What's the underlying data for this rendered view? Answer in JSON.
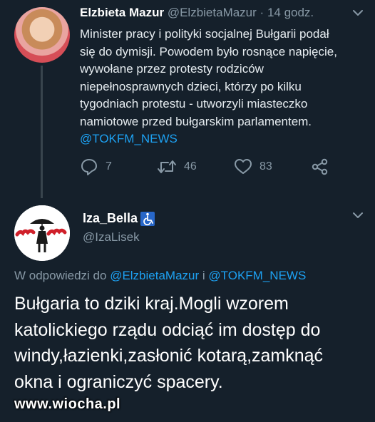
{
  "tweet1": {
    "display_name": "Elzbieta Mazur",
    "handle": "@ElzbietaMazur",
    "separator": "·",
    "time": "14 godz.",
    "body_lines": [
      "Minister pracy i polityki socjalnej Bułgarii podał",
      "się do dymisji. Powodem było rosnące napięcie,",
      "wywołane przez protesty rodziców",
      "niepełnosprawnych dzieci, którzy po kilku",
      "tygodniach protestu - utworzyli miasteczko",
      "namiotowe przed bułgarskim parlamentem."
    ],
    "mention": "@TOKFM_NEWS",
    "replies": "7",
    "retweets": "46",
    "likes": "83"
  },
  "tweet2": {
    "display_name": "Iza_Bella",
    "handle": "@IzaLisek",
    "reply_prefix": "W odpowiedzi do ",
    "reply_mention_1": "@ElzbietaMazur",
    "reply_joiner": " i ",
    "reply_mention_2": "@TOKFM_NEWS",
    "body_lines": [
      "Bułgaria to dziki kraj.Mogli wzorem",
      "katolickiego rządu odciąć im dostęp do",
      "windy,łazienki,zasłonić kotarą,zamknąć",
      "okna i ograniczyć spacery."
    ],
    "avatar_logo_text": "Solidarność"
  },
  "watermark": "www.wiocha.pl",
  "colors": {
    "background": "#15202b",
    "secondary_text": "#8899a6",
    "link": "#1da1f2",
    "thread_line": "#38444d"
  }
}
